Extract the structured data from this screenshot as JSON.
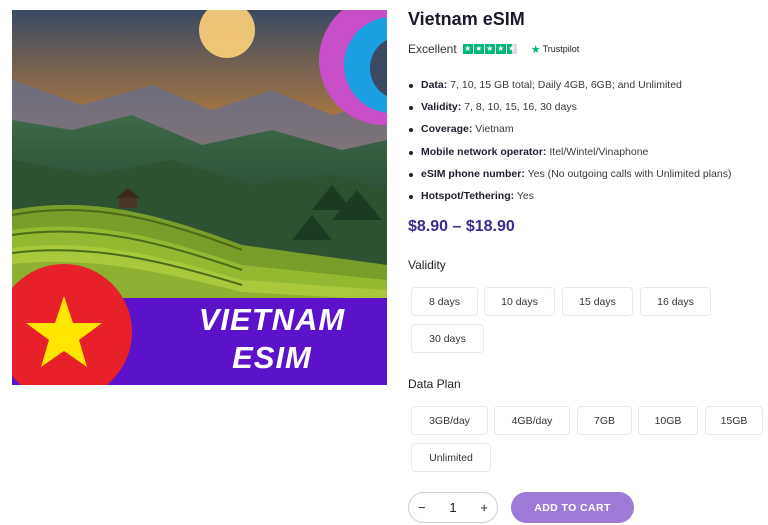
{
  "product": {
    "title": "Vietnam eSIM",
    "rating_label": "Excellent",
    "rating_stars": 4.5,
    "rating_source": "Trustpilot",
    "image_text": [
      "VIETNAM",
      "ESIM"
    ],
    "features": [
      {
        "label": "Data:",
        "value": "7, 10, 15 GB total; Daily 4GB, 6GB; and Unlimited"
      },
      {
        "label": "Validity:",
        "value": "7, 8, 10, 15, 16, 30 days"
      },
      {
        "label": "Coverage:",
        "value": "Vietnam"
      },
      {
        "label": "Mobile network operator:",
        "value": "Itel/Wintel/Vinaphone"
      },
      {
        "label": "eSIM phone number:",
        "value": "Yes (No outgoing calls with Unlimited plans)"
      },
      {
        "label": "Hotspot/Tethering:",
        "value": "Yes"
      }
    ],
    "price_range": "$8.90 – $18.90"
  },
  "validity": {
    "label": "Validity",
    "options": [
      "8 days",
      "10 days",
      "15 days",
      "16 days",
      "30 days"
    ]
  },
  "data_plan": {
    "label": "Data Plan",
    "options": [
      "3GB/day",
      "4GB/day",
      "7GB",
      "10GB",
      "15GB",
      "Unlimited"
    ]
  },
  "cart": {
    "minus": "−",
    "quantity": "1",
    "plus": "+",
    "add_label": "ADD TO CART"
  },
  "colors": {
    "price": "#3b2a8f",
    "button": "#9d7ad6",
    "trustpilot": "#00b67a",
    "banner": "#5b12c9",
    "flag_red": "#e8202a",
    "flag_star": "#ffe600"
  }
}
